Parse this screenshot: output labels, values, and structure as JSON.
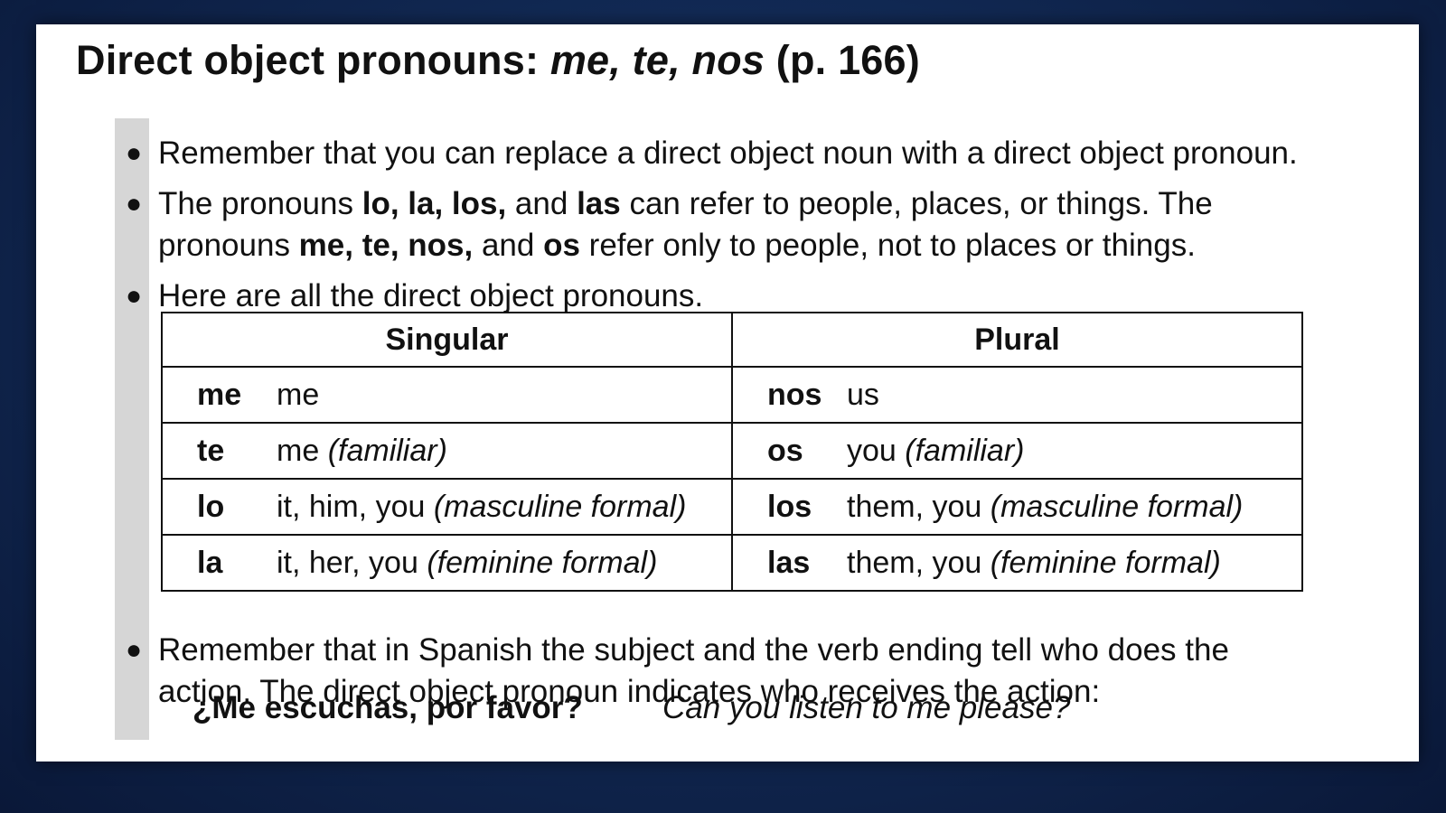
{
  "title": {
    "prefix": "Direct object pronouns: ",
    "italic": "me, te, nos",
    "suffix": " (p. 166)"
  },
  "bullets": {
    "b1": "Remember that you can replace a direct object noun with a direct object pronoun.",
    "b2": {
      "p1": "The pronouns ",
      "bold1": "lo, la, los,",
      "p2": " and ",
      "bold2": "las",
      "p3": " can refer to people, places, or things. The",
      "p4": "pronouns ",
      "bold3": "me, te, nos,",
      "p5": " and ",
      "bold4": "os",
      "p6": " refer only to people, not to places or things."
    },
    "b3": "Here are all the direct object pronouns.",
    "b4": {
      "line1": "Remember that in Spanish the subject and the verb ending tell who does the",
      "line2": "action. The direct object pronoun indicates who receives the action:"
    }
  },
  "table": {
    "headers": [
      "Singular",
      "Plural"
    ],
    "rows": [
      {
        "sg_pron": "me",
        "sg_meaning": "me",
        "sg_note": "",
        "pl_pron": "nos",
        "pl_meaning": "us",
        "pl_note": ""
      },
      {
        "sg_pron": "te",
        "sg_meaning": "me ",
        "sg_note": "(familiar)",
        "pl_pron": "os",
        "pl_meaning": "you ",
        "pl_note": "(familiar)"
      },
      {
        "sg_pron": "lo",
        "sg_meaning": "it, him, you ",
        "sg_note": "(masculine formal)",
        "pl_pron": "los",
        "pl_meaning": "them, you ",
        "pl_note": "(masculine formal)"
      },
      {
        "sg_pron": "la",
        "sg_meaning": "it, her, you ",
        "sg_note": "(feminine formal)",
        "pl_pron": "las",
        "pl_meaning": "them, you ",
        "pl_note": "(feminine formal)"
      }
    ]
  },
  "example": {
    "spanish": "¿Me escuchas, por favor?",
    "english": "Can you listen to me please?"
  }
}
